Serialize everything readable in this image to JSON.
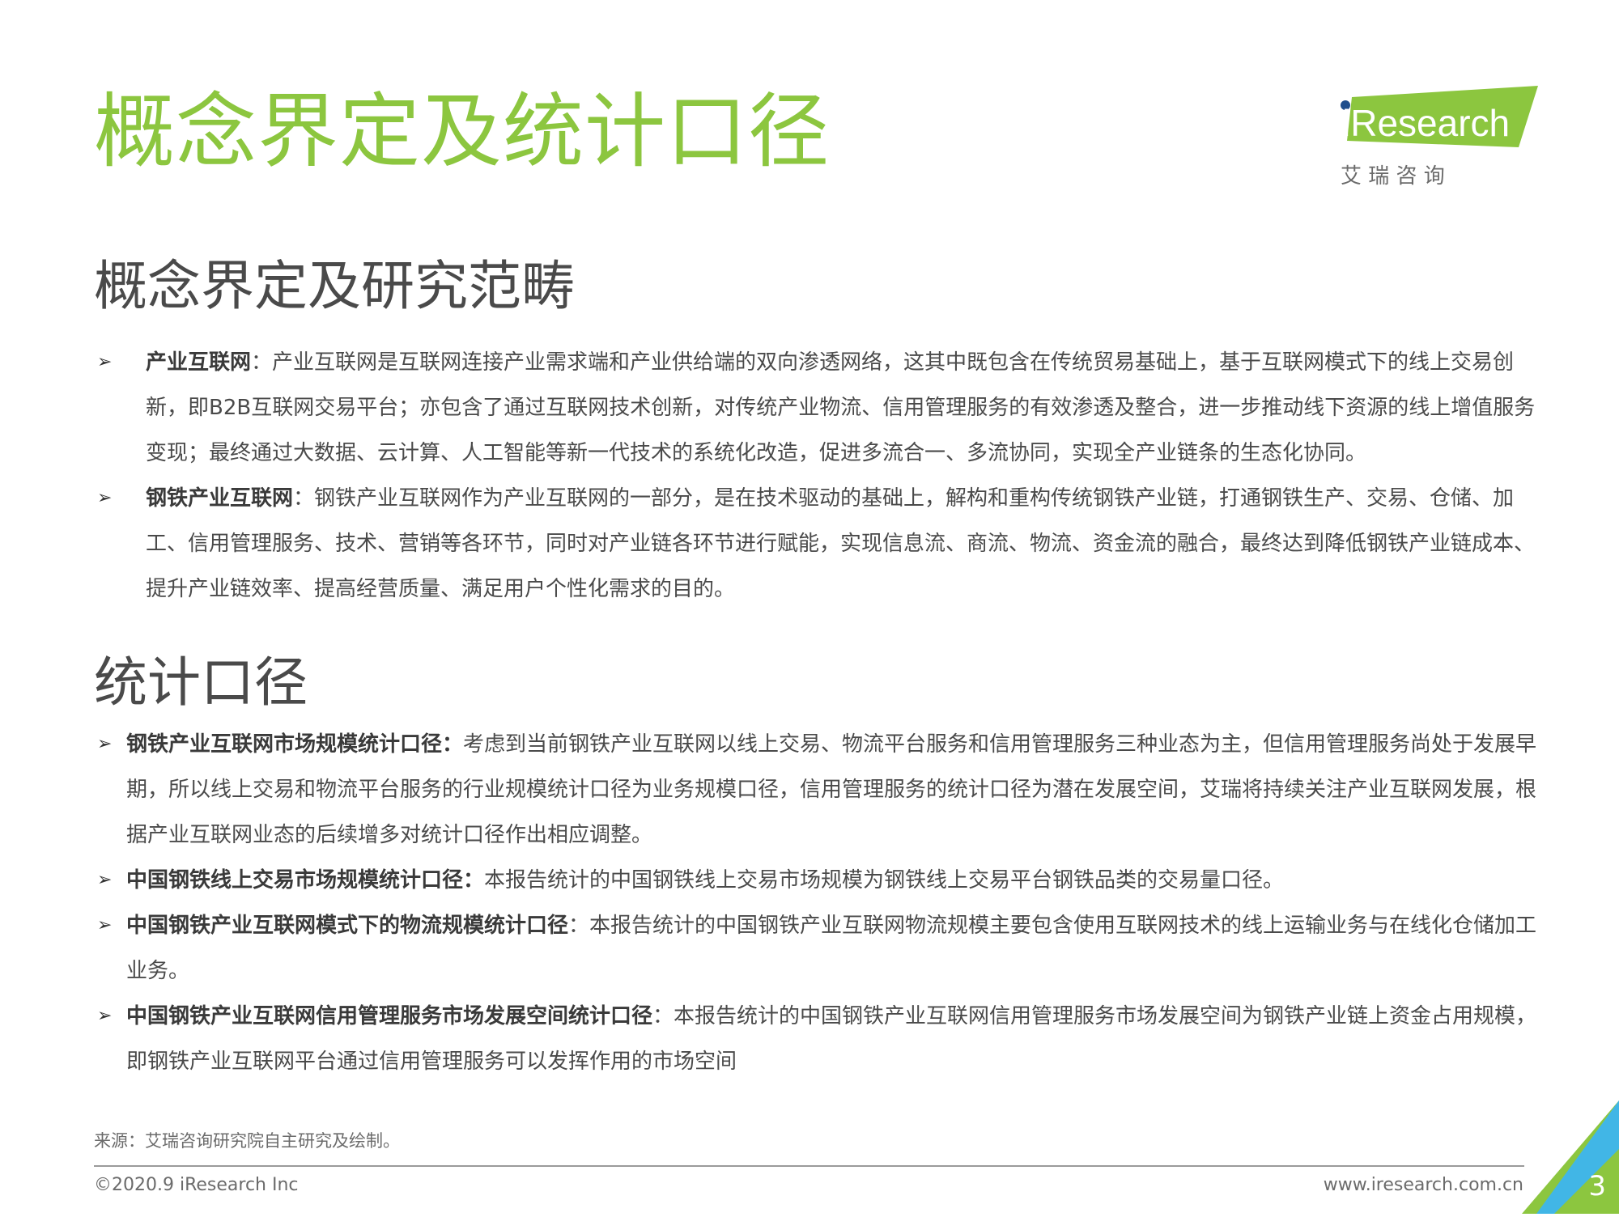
{
  "title": "概念界定及统计口径",
  "logo": {
    "brand": "iResearch",
    "sub": "艾 瑞 咨 询",
    "color": "#8cc63f",
    "dot_color": "#1f4e8c"
  },
  "concept": {
    "heading": "概念界定及研究范畴",
    "items": [
      {
        "term": "产业互联网",
        "sep": "：",
        "text": "产业互联网是互联网连接产业需求端和产业供给端的双向渗透网络，这其中既包含在传统贸易基础上，基于互联网模式下的线上交易创新，即B2B互联网交易平台；亦包含了通过互联网技术创新，对传统产业物流、信用管理服务的有效渗透及整合，进一步推动线下资源的线上增值服务变现；最终通过大数据、云计算、人工智能等新一代技术的系统化改造，促进多流合一、多流协同，实现全产业链条的生态化协同。"
      },
      {
        "term": "钢铁产业互联网",
        "sep": "：",
        "text": "钢铁产业互联网作为产业互联网的一部分，是在技术驱动的基础上，解构和重构传统钢铁产业链，打通钢铁生产、交易、仓储、加工、信用管理服务、技术、营销等各环节，同时对产业链各环节进行赋能，实现信息流、商流、物流、资金流的融合，最终达到降低钢铁产业链成本、提升产业链效率、提高经营质量、满足用户个性化需求的目的。"
      }
    ]
  },
  "stats": {
    "heading": "统计口径",
    "items": [
      {
        "term": "钢铁产业互联网市场规模统计口径：",
        "sep": "",
        "text": "考虑到当前钢铁产业互联网以线上交易、物流平台服务和信用管理服务三种业态为主，但信用管理服务尚处于发展早期，所以线上交易和物流平台服务的行业规模统计口径为业务规模口径，信用管理服务的统计口径为潜在发展空间，艾瑞将持续关注产业互联网发展，根据产业互联网业态的后续增多对统计口径作出相应调整。"
      },
      {
        "term": "中国钢铁线上交易市场规模统计口径：",
        "sep": "",
        "text": "本报告统计的中国钢铁线上交易市场规模为钢铁线上交易平台钢铁品类的交易量口径。"
      },
      {
        "term": "中国钢铁产业互联网模式下的物流规模统计口径",
        "sep": "：",
        "text": "本报告统计的中国钢铁产业互联网物流规模主要包含使用互联网技术的线上运输业务与在线化仓储加工业务。"
      },
      {
        "term": "中国钢铁产业互联网信用管理服务市场发展空间统计口径",
        "sep": "：",
        "text": "本报告统计的中国钢铁产业互联网信用管理服务市场发展空间为钢铁产业链上资金占用规模，即钢铁产业互联网平台通过信用管理服务可以发挥作用的市场空间"
      }
    ]
  },
  "footer": {
    "source": "来源：艾瑞咨询研究院自主研究及绘制。",
    "copyright": "©2020.9 iResearch Inc",
    "website": "www.iresearch.com.cn",
    "page": "3"
  }
}
